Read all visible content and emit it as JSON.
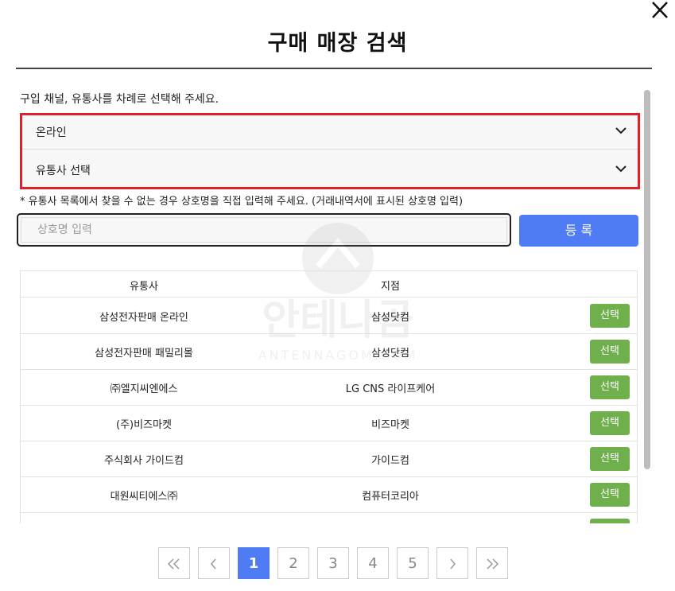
{
  "dialog": {
    "title": "구매 매장 검색",
    "instruction": "구입 채널, 유통사를 차례로 선택해 주세요.",
    "channel_select": {
      "value": "온라인"
    },
    "distributor_select": {
      "value": "유통사 선택"
    },
    "note": "* 유통사 목록에서 찾을 수 없는 경우 상호명을 직접 입력해 주세요. (거래내역서에 표시된 상호명 입력)",
    "store_input": {
      "placeholder": "상호명 입력",
      "value": ""
    },
    "register_label": "등 록"
  },
  "table": {
    "headers": [
      "유통사",
      "지점"
    ],
    "select_label": "선택",
    "rows": [
      {
        "distributor": "삼성전자판매 온라인",
        "branch": "삼성닷컴"
      },
      {
        "distributor": "삼성전자판매 패밀리몰",
        "branch": "삼성닷컴"
      },
      {
        "distributor": "㈜엘지씨엔에스",
        "branch": "LG CNS 라이프케어"
      },
      {
        "distributor": "(주)비즈마켓",
        "branch": "비즈마켓"
      },
      {
        "distributor": "주식회사 가이드컴",
        "branch": "가이드컴"
      },
      {
        "distributor": "대원씨티에스㈜",
        "branch": "컴퓨터코리아"
      },
      {
        "distributor": "",
        "branch": ""
      }
    ]
  },
  "pagination": {
    "first": "«",
    "prev": "‹",
    "pages": [
      "1",
      "2",
      "3",
      "4",
      "5"
    ],
    "current_page": "1",
    "next": "›",
    "last": "»"
  },
  "watermark": {
    "text": "안테나곰",
    "subtext": "ANTENNAGOM.COM"
  },
  "colors": {
    "accent": "#4f7bf4",
    "select_button": "#6fb04d",
    "highlight_border": "#e0202a"
  },
  "icons": {
    "close": "close-icon",
    "dropdown": "chevron-down-icon"
  }
}
